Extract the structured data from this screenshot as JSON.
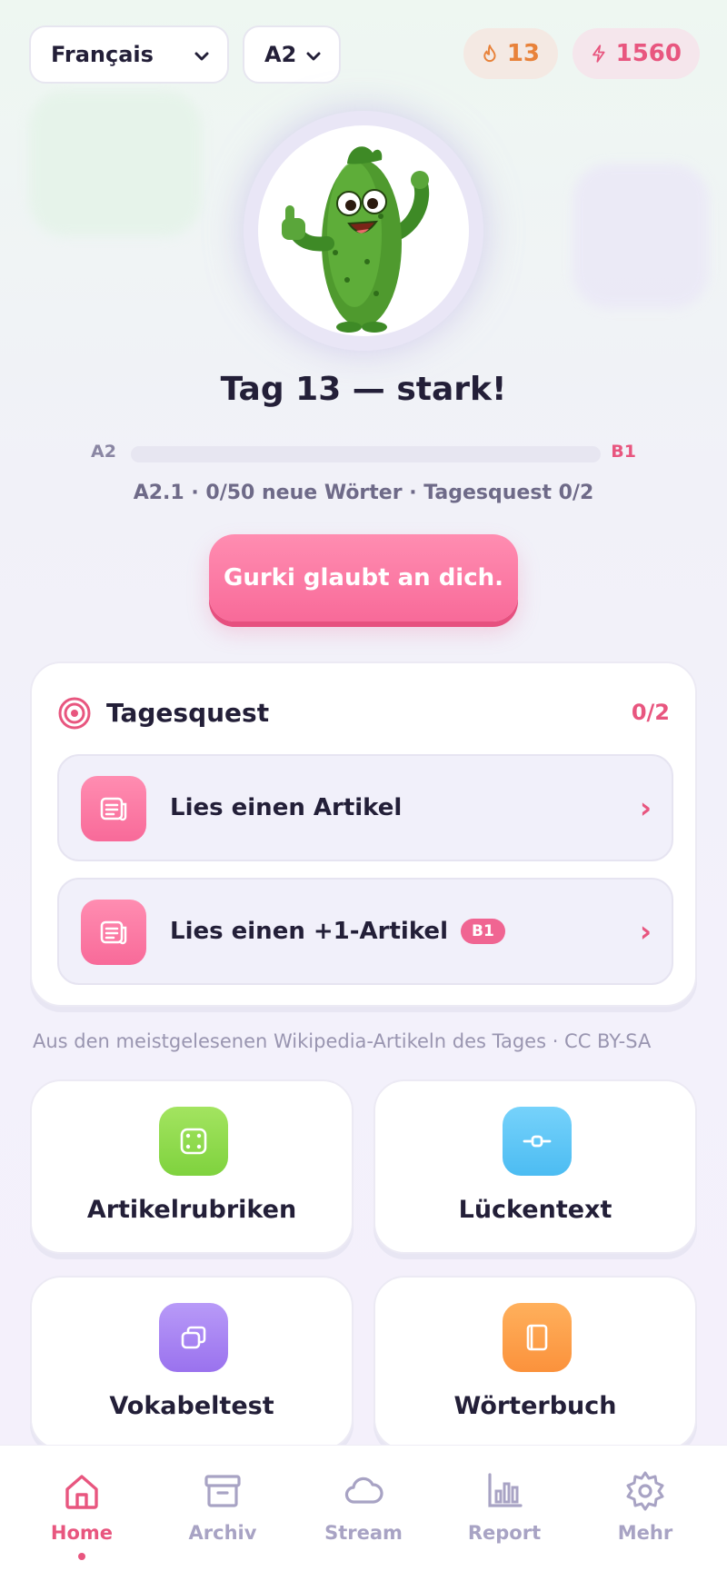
{
  "header": {
    "language_select": {
      "value": "Français"
    },
    "level_select": {
      "value": "A2"
    },
    "streak": {
      "icon": "flame-icon",
      "value": "13"
    },
    "xp": {
      "icon": "lightning-icon",
      "value": "1560"
    }
  },
  "hero": {
    "mascot": "cucumber-mascot",
    "title": "Tag 13 — stark!",
    "progress": {
      "from": "A2",
      "to": "B1",
      "fraction": 0
    },
    "subline": "A2.1 · 0/50 neue Wörter · Tagesquest 0/2",
    "cta_label": "Gurki glaubt an dich."
  },
  "quest": {
    "title": "Tagesquest",
    "count": "0/2",
    "items": [
      {
        "label": "Lies einen Artikel",
        "badge": "",
        "icon": "article-icon"
      },
      {
        "label": "Lies einen +1-Artikel",
        "badge": "B1",
        "icon": "article-icon"
      }
    ],
    "arrow": "›"
  },
  "source_note": "Aus den meistgelesenen Wikipedia-Artikeln des Tages · CC BY-SA",
  "tiles": [
    {
      "label": "Artikelrubriken",
      "icon": "dice-icon",
      "color": "#8fdc4c"
    },
    {
      "label": "Lückentext",
      "icon": "gap-icon",
      "color": "#5ec5f6"
    },
    {
      "label": "Vokabeltest",
      "icon": "cards-icon",
      "color": "#a682f2"
    },
    {
      "label": "Wörterbuch",
      "icon": "book-icon",
      "color": "#fda24a"
    }
  ],
  "nav": [
    {
      "label": "Home",
      "icon": "home-icon",
      "active": true
    },
    {
      "label": "Archiv",
      "icon": "archive-icon",
      "active": false
    },
    {
      "label": "Stream",
      "icon": "cloud-icon",
      "active": false
    },
    {
      "label": "Report",
      "icon": "chart-icon",
      "active": false
    },
    {
      "label": "Mehr",
      "icon": "gear-icon",
      "active": false
    }
  ],
  "colors": {
    "accent_pink": "#e8567f",
    "streak_orange": "#e8823a",
    "text_dark": "#231f38",
    "muted": "#a8a3c4"
  }
}
